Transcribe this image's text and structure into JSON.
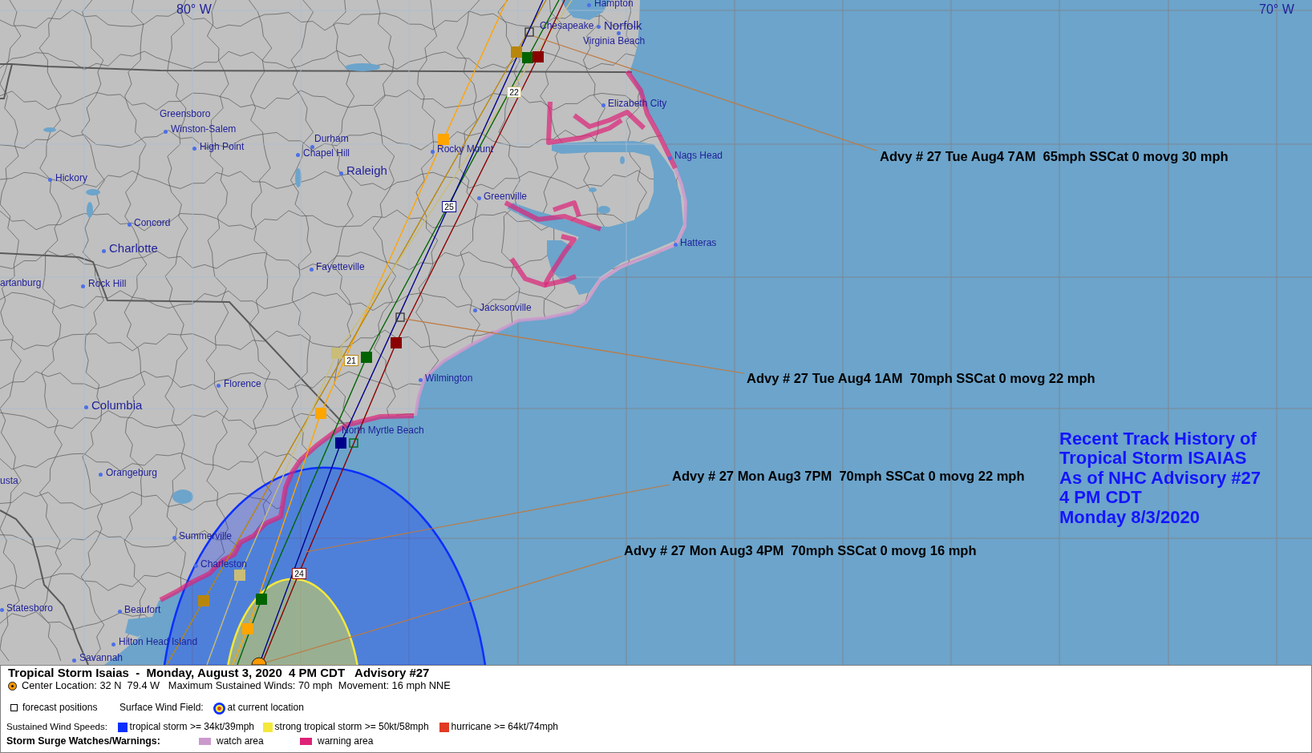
{
  "map": {
    "graticule_labels": [
      "80° W",
      "70° W"
    ],
    "cities": [
      {
        "name": "Hampton",
        "kind": "minor"
      },
      {
        "name": "Chesapeake",
        "kind": "minor"
      },
      {
        "name": "Norfolk",
        "kind": "major"
      },
      {
        "name": "Virginia Beach",
        "kind": "minor"
      },
      {
        "name": "Elizabeth City",
        "kind": "minor"
      },
      {
        "name": "Greensboro",
        "kind": "minor"
      },
      {
        "name": "Winston-Salem",
        "kind": "minor"
      },
      {
        "name": "Durham",
        "kind": "minor"
      },
      {
        "name": "High Point",
        "kind": "minor"
      },
      {
        "name": "Rocky Mount",
        "kind": "minor"
      },
      {
        "name": "Nags Head",
        "kind": "minor"
      },
      {
        "name": "Chapel Hill",
        "kind": "minor"
      },
      {
        "name": "Raleigh",
        "kind": "major"
      },
      {
        "name": "Hickory",
        "kind": "minor"
      },
      {
        "name": "Greenville",
        "kind": "minor"
      },
      {
        "name": "Concord",
        "kind": "minor"
      },
      {
        "name": "Hatteras",
        "kind": "minor"
      },
      {
        "name": "Charlotte",
        "kind": "major"
      },
      {
        "name": "Fayetteville",
        "kind": "minor"
      },
      {
        "name": "artanburg",
        "kind": "minor"
      },
      {
        "name": "Rock Hill",
        "kind": "minor"
      },
      {
        "name": "Jacksonville",
        "kind": "minor"
      },
      {
        "name": "Wilmington",
        "kind": "minor"
      },
      {
        "name": "Florence",
        "kind": "minor"
      },
      {
        "name": "Columbia",
        "kind": "major"
      },
      {
        "name": "North Myrtle Beach",
        "kind": "minor"
      },
      {
        "name": "Orangeburg",
        "kind": "minor"
      },
      {
        "name": "usta",
        "kind": "minor"
      },
      {
        "name": "Summerville",
        "kind": "minor"
      },
      {
        "name": "Charleston",
        "kind": "minor"
      },
      {
        "name": "Statesboro",
        "kind": "minor"
      },
      {
        "name": "Beaufort",
        "kind": "minor"
      },
      {
        "name": "Hilton Head Island",
        "kind": "minor"
      },
      {
        "name": "Savannah",
        "kind": "minor"
      }
    ],
    "tracks": [
      {
        "color": "#ffa500"
      },
      {
        "color": "#b8860b",
        "tag": "21"
      },
      {
        "color": "#c9bd78",
        "tag": "22"
      },
      {
        "color": "#006400"
      },
      {
        "color": "#00008b",
        "tag": "25"
      },
      {
        "color": "#8b0000",
        "tag": "24"
      }
    ],
    "advisory_labels": [
      "Advy # 27 Tue Aug4 7AM  65mph SSCat 0 movg 30 mph",
      "Advy # 27 Tue Aug4 1AM  70mph SSCat 0 movg 22 mph",
      "Advy # 27 Mon Aug3 7PM  70mph SSCat 0 movg 22 mph",
      "Advy # 27 Mon Aug3 4PM  70mph SSCat 0 movg 16 mph"
    ],
    "title_lines": [
      "Recent Track History of",
      "Tropical Storm ISAIAS",
      "As of NHC Advisory #27",
      "4 PM CDT",
      "Monday 8/3/2020"
    ]
  },
  "legend": {
    "title": "Tropical Storm Isaias  -  Monday, August 3, 2020  4 PM CDT   Advisory #27",
    "center_info": "Center Location: 32 N  79.4 W   Maximum Sustained Winds: 70 mph  Movement: 16 mph NNE",
    "forecast_positions": "forecast positions",
    "surface_wind_field": {
      "label": "Surface Wind Field:",
      "value": "at current location"
    },
    "wind_speeds": {
      "label": "Sustained Wind Speeds:",
      "items": [
        {
          "label": "tropical storm >= 34kt/39mph",
          "color": "#0b2fff"
        },
        {
          "label": "strong tropical storm >= 50kt/58mph",
          "color": "#f4e83a"
        },
        {
          "label": "hurricane >= 64kt/74mph",
          "color": "#e03a24"
        }
      ]
    },
    "storm_surge": {
      "label": "Storm Surge Watches/Warnings:",
      "items": [
        {
          "label": "watch area",
          "color": "#cc99cc"
        },
        {
          "label": "warning area",
          "color": "#dd2277"
        }
      ]
    }
  }
}
